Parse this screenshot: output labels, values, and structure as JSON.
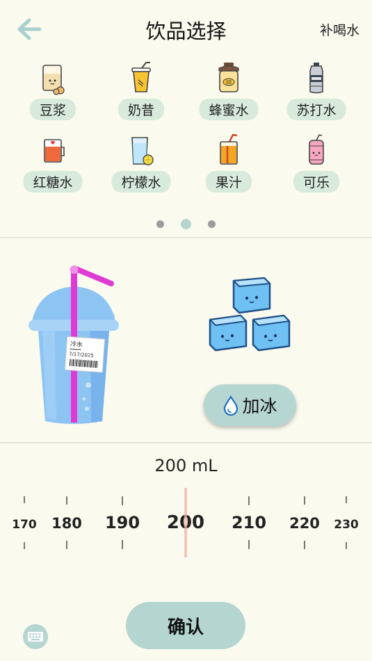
{
  "header": {
    "title": "饮品选择",
    "extra": "补喝水"
  },
  "drinks": [
    {
      "label": "豆浆",
      "icon": "soy-milk-icon"
    },
    {
      "label": "奶昔",
      "icon": "milkshake-icon"
    },
    {
      "label": "蜂蜜水",
      "icon": "honey-water-icon"
    },
    {
      "label": "苏打水",
      "icon": "soda-water-icon"
    },
    {
      "label": "红糖水",
      "icon": "brown-sugar-water-icon"
    },
    {
      "label": "柠檬水",
      "icon": "lemonade-icon"
    },
    {
      "label": "果汁",
      "icon": "juice-icon"
    },
    {
      "label": "可乐",
      "icon": "cola-icon"
    }
  ],
  "pager": {
    "pages": 3,
    "active": 2
  },
  "cup": {
    "label_name": "冷水",
    "label_date": "7/17/2025"
  },
  "add_ice_label": "加冰",
  "volume": {
    "value": "200 mL"
  },
  "ruler": {
    "labels": [
      "170",
      "180",
      "190",
      "200",
      "210",
      "220",
      "230"
    ],
    "selected": "200"
  },
  "confirm_label": "确认",
  "colors": {
    "background": "#fafaee",
    "accent": "#b5d5d0",
    "chip": "#d8eadc",
    "indicator": "#f2b4a8"
  }
}
